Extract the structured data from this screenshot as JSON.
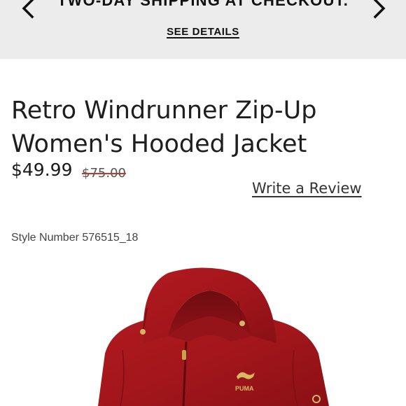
{
  "banner": {
    "headline": "TWO-DAY SHIPPING AT CHECKOUT.",
    "details_link": "SEE DETAILS",
    "prev_icon": "chevron-left-icon",
    "next_icon": "chevron-right-icon"
  },
  "product": {
    "title": "Retro Windrunner Zip-Up Women's Hooded Jacket",
    "price": "$49.99",
    "original_price": "$75.00",
    "write_review": "Write a Review",
    "style_number": "Style Number 576515_18",
    "image_logo_text": "PUMA",
    "jacket_color": "#a3161b"
  }
}
